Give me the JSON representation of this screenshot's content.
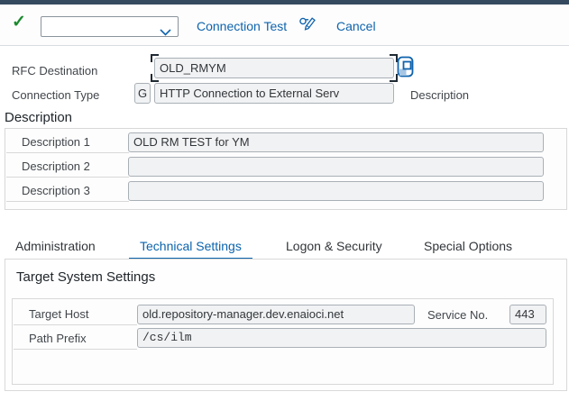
{
  "colors": {
    "shell_bar": "#354a5f",
    "accent_blue": "#0f63ad",
    "positive_green": "#1b8a2f",
    "field_background": "#f1f2f3",
    "active_tab_blue": "#0b63ad"
  },
  "toolbar": {
    "ok_icon": "checkmark-icon",
    "command_field_value": "",
    "connection_test_label": "Connection Test",
    "display_change_icon": "display-change-icon",
    "cancel_label": "Cancel"
  },
  "form": {
    "rfc_destination_label": "RFC Destination",
    "rfc_destination_value": "OLD_RMYM",
    "connection_type_label": "Connection Type",
    "connection_type_code": "G",
    "connection_type_text": "HTTP Connection to External Serv",
    "description_hint_label": "Description"
  },
  "description_section": {
    "title": "Description",
    "rows": [
      {
        "label": "Description 1",
        "value": "OLD RM TEST for YM"
      },
      {
        "label": "Description 2",
        "value": ""
      },
      {
        "label": "Description 3",
        "value": ""
      }
    ]
  },
  "tabs": [
    {
      "label": "Administration",
      "active": false
    },
    {
      "label": "Technical Settings",
      "active": true
    },
    {
      "label": "Logon & Security",
      "active": false
    },
    {
      "label": "Special Options",
      "active": false
    }
  ],
  "technical_settings": {
    "section_title": "Target System Settings",
    "target_host_label": "Target Host",
    "target_host_value": "old.repository-manager.dev.enaioci.net",
    "service_no_label": "Service No.",
    "service_no_value": "443",
    "path_prefix_label": "Path Prefix",
    "path_prefix_value": "/cs/ilm"
  }
}
